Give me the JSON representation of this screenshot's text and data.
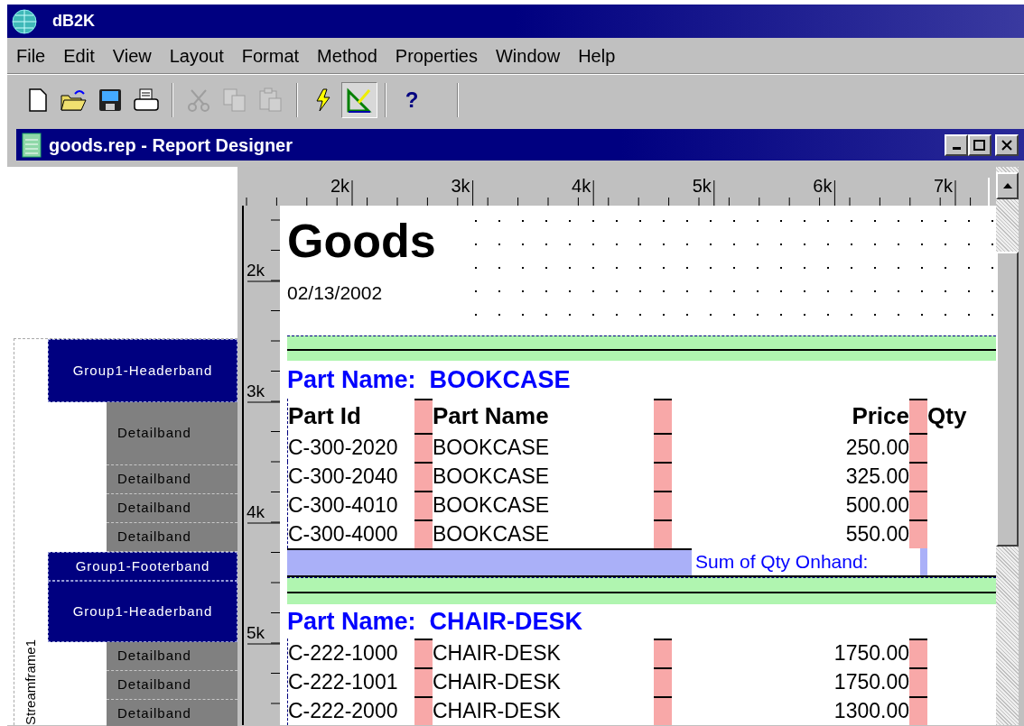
{
  "app": {
    "title": "dB2K"
  },
  "menu": [
    {
      "label": "File"
    },
    {
      "label": "Edit"
    },
    {
      "label": "View"
    },
    {
      "label": "Layout"
    },
    {
      "label": "Format"
    },
    {
      "label": "Method"
    },
    {
      "label": "Properties"
    },
    {
      "label": "Window"
    },
    {
      "label": "Help"
    }
  ],
  "toolbar": [
    {
      "kind": "new",
      "disabled": false,
      "selected": false
    },
    {
      "kind": "open",
      "disabled": false,
      "selected": false
    },
    {
      "kind": "save",
      "disabled": false,
      "selected": false
    },
    {
      "kind": "print",
      "disabled": false,
      "selected": false
    },
    {
      "kind": "separator"
    },
    {
      "kind": "cut",
      "disabled": true,
      "selected": false
    },
    {
      "kind": "copy",
      "disabled": true,
      "selected": false
    },
    {
      "kind": "paste",
      "disabled": true,
      "selected": false
    },
    {
      "kind": "separator"
    },
    {
      "kind": "run",
      "disabled": false,
      "selected": false
    },
    {
      "kind": "designer",
      "disabled": false,
      "selected": true
    },
    {
      "kind": "separator"
    },
    {
      "kind": "help",
      "label": "?",
      "disabled": false,
      "selected": false
    }
  ],
  "document_window": {
    "title": "goods.rep - Report Designer"
  },
  "rulers": {
    "top": [
      "2k",
      "3k",
      "4k",
      "5k",
      "6k",
      "7k"
    ],
    "side": [
      "2k",
      "3k",
      "4k",
      "5k"
    ]
  },
  "band_panel": {
    "stream_frame": "Streamframe1",
    "bands": [
      {
        "kind": "group-header",
        "label": "Group1-Headerband"
      },
      {
        "kind": "detail",
        "label": "Detailband"
      },
      {
        "kind": "detail",
        "label": "Detailband"
      },
      {
        "kind": "detail",
        "label": "Detailband"
      },
      {
        "kind": "detail",
        "label": "Detailband"
      },
      {
        "kind": "group-footer",
        "label": "Group1-Footerband"
      },
      {
        "kind": "group-header",
        "label": "Group1-Headerband"
      },
      {
        "kind": "detail",
        "label": "Detailband"
      },
      {
        "kind": "detail",
        "label": "Detailband"
      },
      {
        "kind": "detail",
        "label": "Detailband"
      }
    ]
  },
  "report": {
    "title": "Goods",
    "date": "02/13/2002",
    "groups": [
      {
        "heading": "Part Name:  BOOKCASE",
        "column_headers": [
          "Part Id",
          "Part Name",
          "Price",
          "Qty"
        ],
        "rows": [
          [
            "C-300-2020",
            "BOOKCASE",
            "250.00"
          ],
          [
            "C-300-2040",
            "BOOKCASE",
            "325.00"
          ],
          [
            "C-300-4010",
            "BOOKCASE",
            "500.00"
          ],
          [
            "C-300-4000",
            "BOOKCASE",
            "550.00"
          ]
        ],
        "footer": "Sum of Qty Onhand:"
      },
      {
        "heading": "Part Name:  CHAIR-DESK",
        "rows": [
          [
            "C-222-1000",
            "CHAIR-DESK",
            "1750.00"
          ],
          [
            "C-222-1001",
            "CHAIR-DESK",
            "1750.00"
          ],
          [
            "C-222-2000",
            "CHAIR-DESK",
            "1300.00"
          ]
        ]
      }
    ]
  }
}
